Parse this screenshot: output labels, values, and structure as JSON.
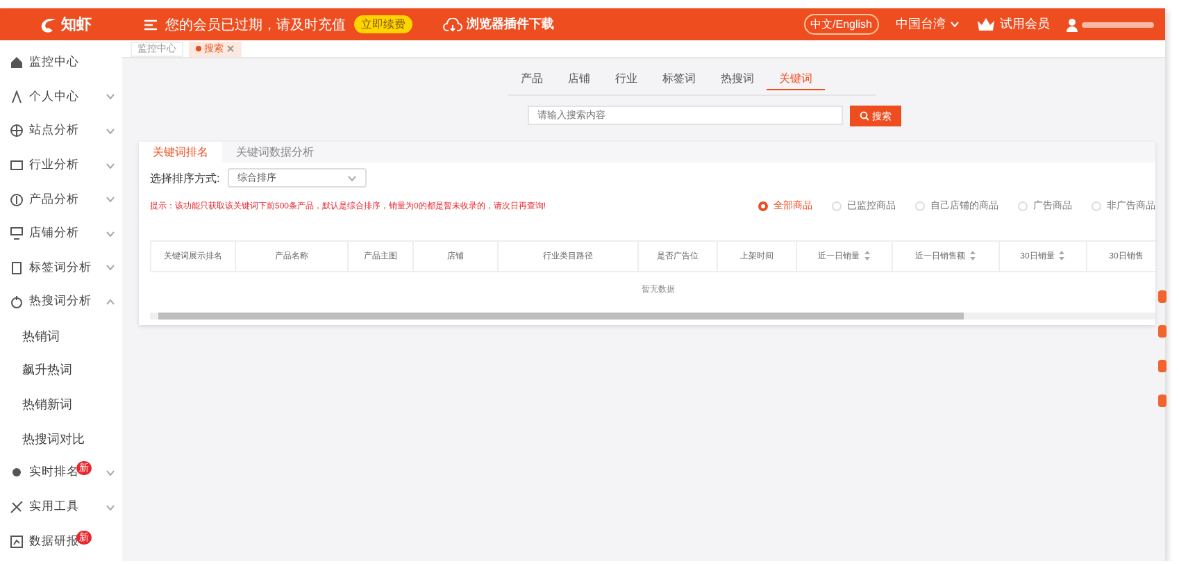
{
  "header": {
    "logo": "知虾",
    "notice": "您的会员已过期，请及时充值",
    "renew_button": "立即续费",
    "plugin_link": "浏览器插件下载",
    "language_toggle": "中文/English",
    "region": "中国台湾",
    "member_level": "试用会员"
  },
  "sidebar": {
    "items": [
      {
        "label": "监控中心"
      },
      {
        "label": "个人中心",
        "expanded": false
      },
      {
        "label": "站点分析",
        "expanded": false
      },
      {
        "label": "行业分析",
        "expanded": false
      },
      {
        "label": "产品分析",
        "expanded": false
      },
      {
        "label": "店铺分析",
        "expanded": false
      },
      {
        "label": "标签词分析",
        "expanded": false
      },
      {
        "label": "热搜词分析",
        "expanded": true,
        "children": [
          {
            "label": "热销词"
          },
          {
            "label": "飙升热词"
          },
          {
            "label": "热销新词"
          },
          {
            "label": "热搜词对比"
          }
        ]
      },
      {
        "label": "实时排名",
        "badge": "新",
        "expanded": false
      },
      {
        "label": "实用工具",
        "expanded": false
      },
      {
        "label": "数据研报",
        "badge": "新"
      }
    ]
  },
  "breadcrumbs": [
    {
      "label": "监控中心",
      "selected": false
    },
    {
      "label": "搜索",
      "selected": true
    }
  ],
  "search_tabs": [
    {
      "label": "产品",
      "selected": false
    },
    {
      "label": "店铺",
      "selected": false
    },
    {
      "label": "行业",
      "selected": false
    },
    {
      "label": "标签词",
      "selected": false
    },
    {
      "label": "热搜词",
      "selected": false
    },
    {
      "label": "关键词",
      "selected": true
    }
  ],
  "search": {
    "placeholder": "请输入搜索内容",
    "button": "搜索"
  },
  "panel": {
    "tabs": [
      {
        "label": "关键词排名",
        "selected": true
      },
      {
        "label": "关键词数据分析",
        "selected": false
      }
    ],
    "sort": {
      "label": "选择排序方式:",
      "value": "综合排序"
    },
    "hint": "提示：该功能只获取该关键词下前500条产品，默认是综合排序，销量为0的都是暂未收录的，请次日再查询!",
    "filters": [
      {
        "label": "全部商品",
        "selected": true
      },
      {
        "label": "已监控商品",
        "selected": false
      },
      {
        "label": "自己店铺的商品",
        "selected": false
      },
      {
        "label": "广告商品",
        "selected": false
      },
      {
        "label": "非广告商品",
        "selected": false
      }
    ],
    "table": {
      "columns": [
        {
          "label": "关键词展示排名",
          "sortable": false
        },
        {
          "label": "产品名称",
          "sortable": false
        },
        {
          "label": "产品主图",
          "sortable": false
        },
        {
          "label": "店铺",
          "sortable": false
        },
        {
          "label": "行业类目路径",
          "sortable": false
        },
        {
          "label": "是否广告位",
          "sortable": false
        },
        {
          "label": "上架时间",
          "sortable": false
        },
        {
          "label": "近一日销量",
          "sortable": true
        },
        {
          "label": "近一日销售额",
          "sortable": true
        },
        {
          "label": "30日销量",
          "sortable": true
        },
        {
          "label": "30日销售",
          "sortable": false
        }
      ],
      "empty_text": "暂无数据"
    }
  }
}
